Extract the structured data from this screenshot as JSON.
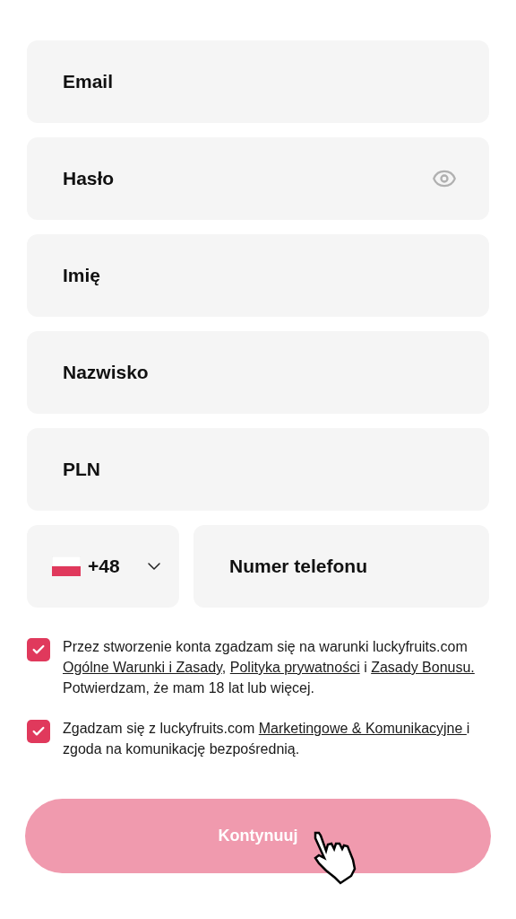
{
  "fields": [
    {
      "placeholder": "Email",
      "kind": "text"
    },
    {
      "placeholder": "Hasło",
      "kind": "password"
    },
    {
      "placeholder": "Imię",
      "kind": "text"
    },
    {
      "placeholder": "Nazwisko",
      "kind": "text"
    },
    {
      "placeholder": "PLN",
      "kind": "text"
    }
  ],
  "phone": {
    "country_code": "+48",
    "placeholder": "Numer telefonu"
  },
  "consents": [
    {
      "checked": true,
      "parts": [
        {
          "text": "Przez stworzenie konta zgadzam się na warunki luckyfruits.com ",
          "link": false
        },
        {
          "text": "Ogólne Warunki i Zasady",
          "link": true
        },
        {
          "text": ", ",
          "link": false
        },
        {
          "text": "Polityka prywatności",
          "link": true
        },
        {
          "text": " i ",
          "link": false
        },
        {
          "text": "Zasady Bonusu.",
          "link": true
        },
        {
          "text": " Potwierdzam, że mam 18 lat lub więcej.",
          "link": false
        }
      ]
    },
    {
      "checked": true,
      "parts": [
        {
          "text": "Zgadzam się z luckyfruits.com ",
          "link": false
        },
        {
          "text": "Marketingowe & Komunikacyjne ",
          "link": true
        },
        {
          "text": "i zgoda na komunikację bezpośrednią.",
          "link": false
        }
      ]
    }
  ],
  "submit": {
    "label": "Kontynuuj",
    "disabled": true
  }
}
